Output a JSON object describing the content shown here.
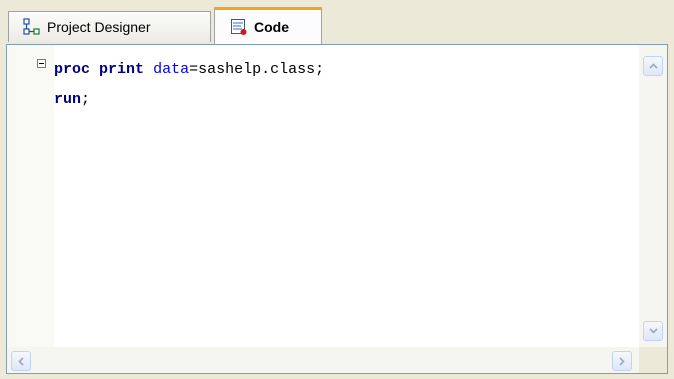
{
  "tabs": [
    {
      "label": "Project Designer",
      "icon": "project-designer-icon",
      "active": false
    },
    {
      "label": "Code",
      "icon": "code-icon",
      "active": true
    }
  ],
  "editor": {
    "lines": [
      {
        "keyword1": "proc",
        "keyword2": "print",
        "option": "data",
        "rest": "=sashelp.class;"
      },
      {
        "keyword1": "run",
        "rest": ";"
      }
    ]
  },
  "colors": {
    "keyword": "#000080",
    "option": "#0000ff",
    "active_tab_accent": "#f7a619"
  }
}
